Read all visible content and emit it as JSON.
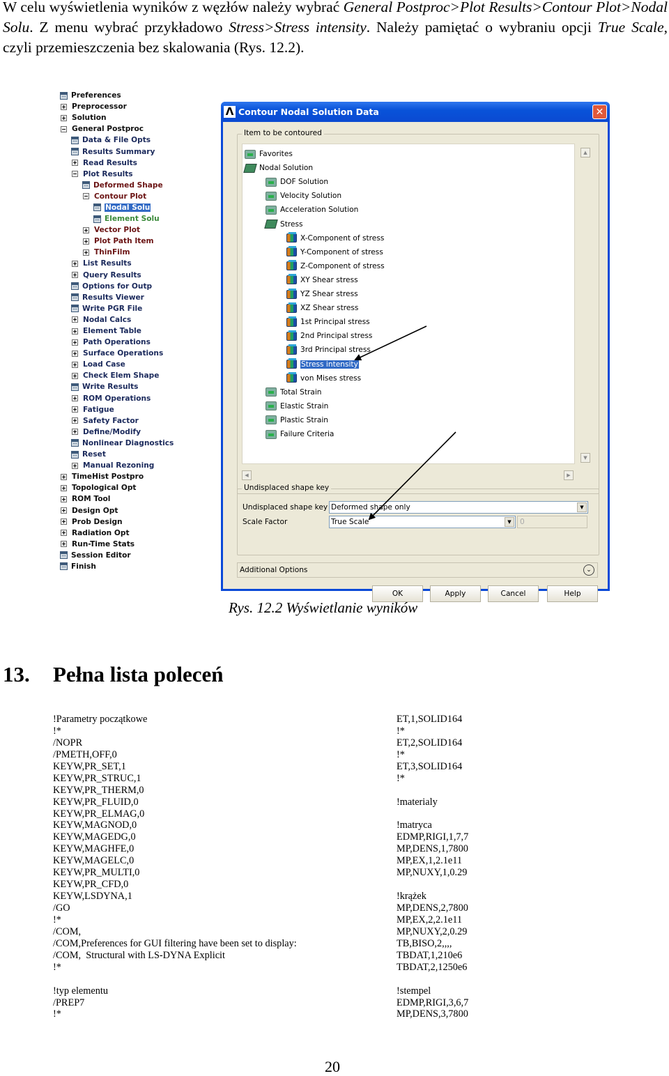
{
  "intro": {
    "p1": "W celu wyświetlenia wyników z węzłów należy wybrać ",
    "i1": "General Postproc>Plot Results>Contour Plot>Nodal Solu",
    "p2": ". Z menu wybrać przykładowo ",
    "i2": "Stress>Stress intensity",
    "p3": ". Należy pamiętać o wybraniu opcji ",
    "i3": "True Scale",
    "p4": ", czyli przemieszczenia bez skalowania (Rys. 12.2)."
  },
  "tree": {
    "items": [
      {
        "label": "Preferences",
        "icon": "cmd",
        "level": 0,
        "color": "black"
      },
      {
        "label": "Preprocessor",
        "icon": "plus",
        "level": 0,
        "color": "black"
      },
      {
        "label": "Solution",
        "icon": "plus",
        "level": 0,
        "color": "black"
      },
      {
        "label": "General Postproc",
        "icon": "minus",
        "level": 0,
        "color": "black"
      },
      {
        "label": "Data & File Opts",
        "icon": "cmd",
        "level": 1,
        "color": "navy"
      },
      {
        "label": "Results Summary",
        "icon": "cmd",
        "level": 1,
        "color": "navy"
      },
      {
        "label": "Read Results",
        "icon": "plus",
        "level": 1,
        "color": "navy"
      },
      {
        "label": "Plot Results",
        "icon": "minus",
        "level": 1,
        "color": "navy"
      },
      {
        "label": "Deformed Shape",
        "icon": "cmd",
        "level": 2,
        "color": "maroon"
      },
      {
        "label": "Contour Plot",
        "icon": "minus",
        "level": 2,
        "color": "maroon"
      },
      {
        "label": "Nodal Solu",
        "icon": "cmd",
        "level": 3,
        "color": "selected"
      },
      {
        "label": "Element Solu",
        "icon": "cmd",
        "level": 3,
        "color": "green"
      },
      {
        "label": "Vector Plot",
        "icon": "plus",
        "level": 2,
        "color": "maroon"
      },
      {
        "label": "Plot Path Item",
        "icon": "plus",
        "level": 2,
        "color": "maroon"
      },
      {
        "label": "ThinFilm",
        "icon": "plus",
        "level": 2,
        "color": "maroon"
      },
      {
        "label": "List Results",
        "icon": "plus",
        "level": 1,
        "color": "navy"
      },
      {
        "label": "Query Results",
        "icon": "plus",
        "level": 1,
        "color": "navy"
      },
      {
        "label": "Options for Outp",
        "icon": "cmd",
        "level": 1,
        "color": "navy"
      },
      {
        "label": "Results Viewer",
        "icon": "cmd",
        "level": 1,
        "color": "navy"
      },
      {
        "label": "Write PGR File",
        "icon": "cmd",
        "level": 1,
        "color": "navy"
      },
      {
        "label": "Nodal Calcs",
        "icon": "plus",
        "level": 1,
        "color": "navy"
      },
      {
        "label": "Element Table",
        "icon": "plus",
        "level": 1,
        "color": "navy"
      },
      {
        "label": "Path Operations",
        "icon": "plus",
        "level": 1,
        "color": "navy"
      },
      {
        "label": "Surface Operations",
        "icon": "plus",
        "level": 1,
        "color": "navy"
      },
      {
        "label": "Load Case",
        "icon": "plus",
        "level": 1,
        "color": "navy"
      },
      {
        "label": "Check Elem Shape",
        "icon": "plus",
        "level": 1,
        "color": "navy"
      },
      {
        "label": "Write Results",
        "icon": "cmd",
        "level": 1,
        "color": "navy"
      },
      {
        "label": "ROM Operations",
        "icon": "plus",
        "level": 1,
        "color": "navy"
      },
      {
        "label": "Fatigue",
        "icon": "plus",
        "level": 1,
        "color": "navy"
      },
      {
        "label": "Safety Factor",
        "icon": "plus",
        "level": 1,
        "color": "navy"
      },
      {
        "label": "Define/Modify",
        "icon": "plus",
        "level": 1,
        "color": "navy"
      },
      {
        "label": "Nonlinear Diagnostics",
        "icon": "cmd",
        "level": 1,
        "color": "navy"
      },
      {
        "label": "Reset",
        "icon": "cmd",
        "level": 1,
        "color": "navy"
      },
      {
        "label": "Manual Rezoning",
        "icon": "plus",
        "level": 1,
        "color": "navy"
      },
      {
        "label": "TimeHist Postpro",
        "icon": "plus",
        "level": 0,
        "color": "black"
      },
      {
        "label": "Topological Opt",
        "icon": "plus",
        "level": 0,
        "color": "black"
      },
      {
        "label": "ROM Tool",
        "icon": "plus",
        "level": 0,
        "color": "black"
      },
      {
        "label": "Design Opt",
        "icon": "plus",
        "level": 0,
        "color": "black"
      },
      {
        "label": "Prob Design",
        "icon": "plus",
        "level": 0,
        "color": "black"
      },
      {
        "label": "Radiation Opt",
        "icon": "plus",
        "level": 0,
        "color": "black"
      },
      {
        "label": "Run-Time Stats",
        "icon": "plus",
        "level": 0,
        "color": "black"
      },
      {
        "label": "Session Editor",
        "icon": "cmd",
        "level": 0,
        "color": "black"
      },
      {
        "label": "Finish",
        "icon": "cmd",
        "level": 0,
        "color": "black"
      }
    ]
  },
  "dialog": {
    "title": "Contour Nodal Solution Data",
    "logo": "Λ",
    "close": "✕",
    "group1_title": "Item to be contoured",
    "list": [
      {
        "label": "Favorites",
        "icon": "folder",
        "level": 0
      },
      {
        "label": "Nodal Solution",
        "icon": "nodal",
        "level": 0
      },
      {
        "label": "DOF Solution",
        "icon": "folder",
        "level": 1
      },
      {
        "label": "Velocity Solution",
        "icon": "folder",
        "level": 1
      },
      {
        "label": "Acceleration Solution",
        "icon": "folder",
        "level": 1
      },
      {
        "label": "Stress",
        "icon": "nodal",
        "level": 1
      },
      {
        "label": "X-Component of stress",
        "icon": "cube",
        "level": 2
      },
      {
        "label": "Y-Component of stress",
        "icon": "cube",
        "level": 2
      },
      {
        "label": "Z-Component of stress",
        "icon": "cube",
        "level": 2
      },
      {
        "label": "XY Shear stress",
        "icon": "cube",
        "level": 2
      },
      {
        "label": "YZ Shear stress",
        "icon": "cube",
        "level": 2
      },
      {
        "label": "XZ Shear stress",
        "icon": "cube",
        "level": 2
      },
      {
        "label": "1st Principal stress",
        "icon": "cube",
        "level": 2
      },
      {
        "label": "2nd Principal stress",
        "icon": "cube",
        "level": 2
      },
      {
        "label": "3rd Principal stress",
        "icon": "cube",
        "level": 2
      },
      {
        "label": "Stress intensity",
        "icon": "cube",
        "level": 2,
        "selected": true
      },
      {
        "label": "von Mises stress",
        "icon": "cube",
        "level": 2
      },
      {
        "label": "Total Strain",
        "icon": "folder",
        "level": 1
      },
      {
        "label": "Elastic Strain",
        "icon": "folder",
        "level": 1
      },
      {
        "label": "Plastic Strain",
        "icon": "folder",
        "level": 1
      },
      {
        "label": "Failure Criteria",
        "icon": "folder",
        "level": 1
      }
    ],
    "group2_title": "Undisplaced shape key",
    "undisplaced_label": "Undisplaced shape key",
    "undisplaced_value": "Deformed shape only",
    "scale_label": "Scale Factor",
    "scale_value": "True Scale",
    "scale_number": "0",
    "additional_options": "Additional Options",
    "buttons": {
      "ok": "OK",
      "apply": "Apply",
      "cancel": "Cancel",
      "help": "Help"
    },
    "selection_color": "#316ac5"
  },
  "caption": "Rys. 12.2 Wyświetlanie wyników",
  "heading": {
    "number": "13.",
    "title": "Pełna lista poleceń"
  },
  "code_left": [
    "!Parametry początkowe",
    "!*",
    "/NOPR",
    "/PMETH,OFF,0",
    "KEYW,PR_SET,1",
    "KEYW,PR_STRUC,1",
    "KEYW,PR_THERM,0",
    "KEYW,PR_FLUID,0",
    "KEYW,PR_ELMAG,0",
    "KEYW,MAGNOD,0",
    "KEYW,MAGEDG,0",
    "KEYW,MAGHFE,0",
    "KEYW,MAGELC,0",
    "KEYW,PR_MULTI,0",
    "KEYW,PR_CFD,0",
    "KEYW,LSDYNA,1",
    "/GO",
    "!*",
    "/COM,",
    "/COM,Preferences for GUI filtering have been set to display:",
    "/COM,  Structural with LS-DYNA Explicit",
    "!*",
    "",
    "!typ elementu",
    "/PREP7",
    "!*"
  ],
  "code_right": [
    "ET,1,SOLID164",
    "!*",
    "ET,2,SOLID164",
    "!*",
    "ET,3,SOLID164",
    "!*",
    "",
    "!materialy",
    "",
    "!matryca",
    "EDMP,RIGI,1,7,7",
    "MP,DENS,1,7800",
    "MP,EX,1,2.1e11",
    "MP,NUXY,1,0.29",
    "",
    "!krążek",
    "MP,DENS,2,7800",
    "MP,EX,2,2.1e11",
    "MP,NUXY,2,0.29",
    "TB,BISO,2,,,,",
    "TBDAT,1,210e6",
    "TBDAT,2,1250e6",
    "",
    "!stempel",
    "EDMP,RIGI,3,6,7",
    "MP,DENS,3,7800"
  ],
  "page_number": "20"
}
